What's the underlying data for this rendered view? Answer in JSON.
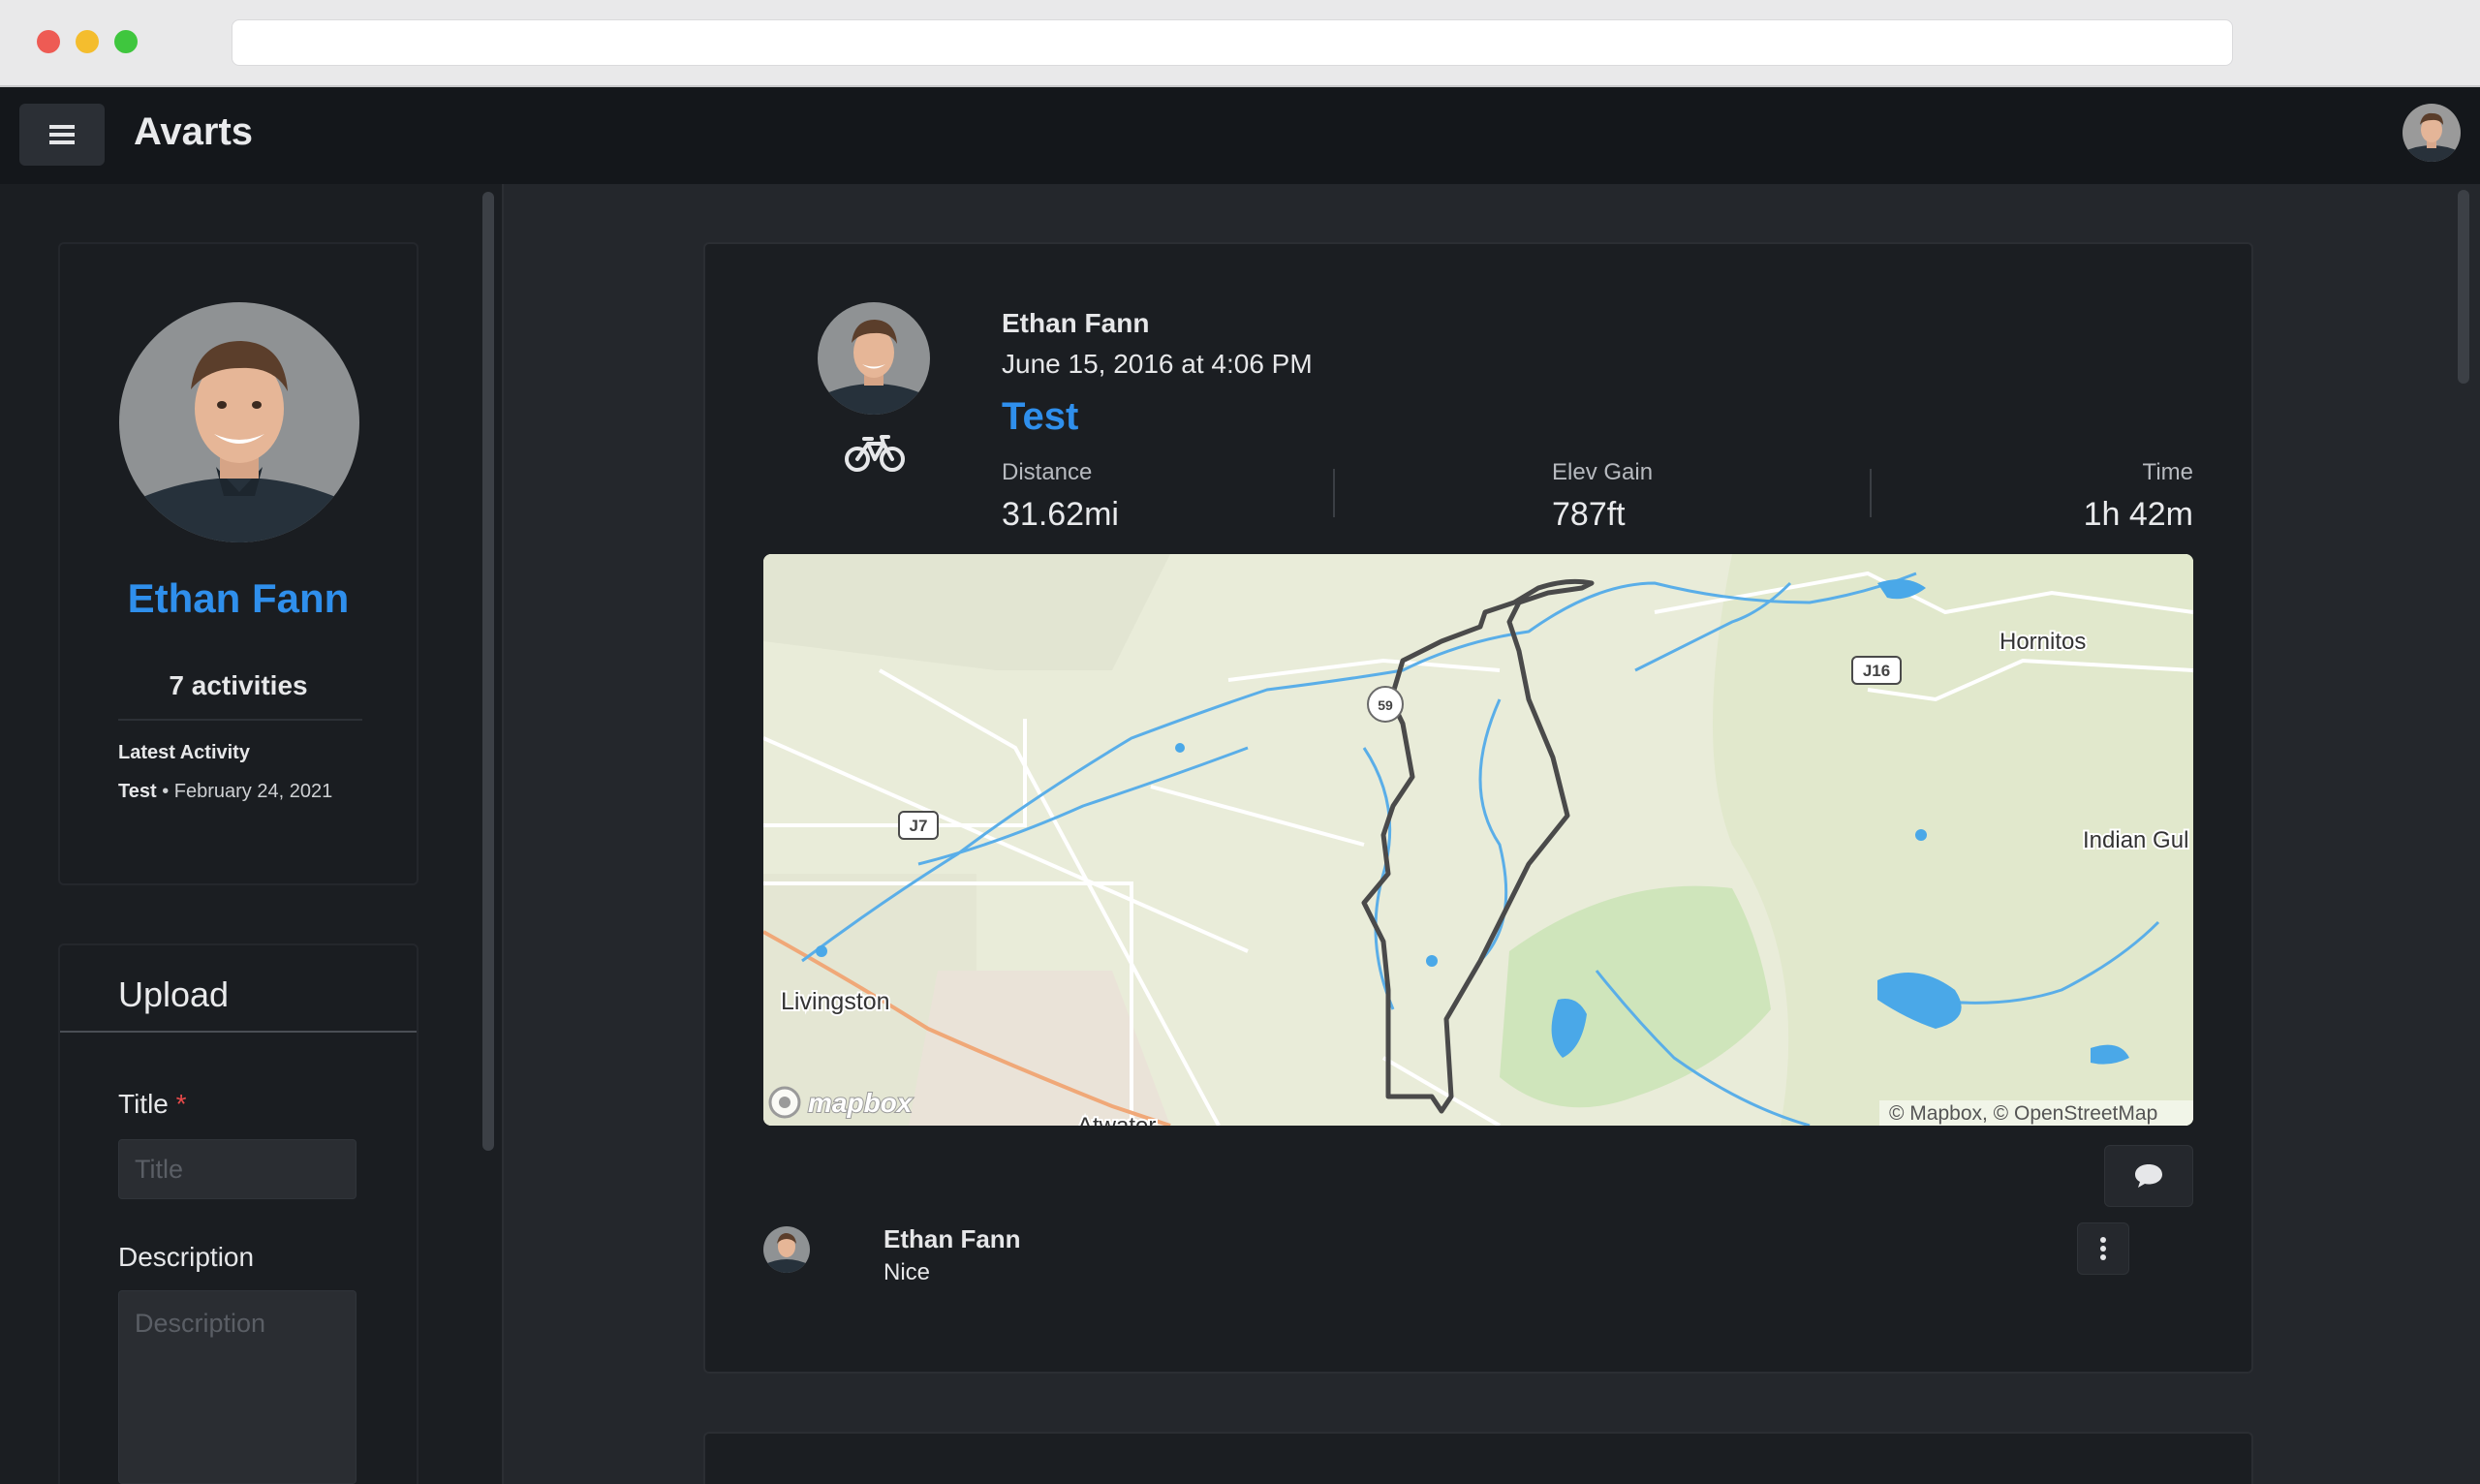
{
  "app": {
    "brand": "Avarts"
  },
  "profile": {
    "name": "Ethan Fann",
    "activity_count": "7 activities",
    "latest_label": "Latest Activity",
    "latest_title": "Test",
    "latest_separator": " • ",
    "latest_date": "February 24, 2021"
  },
  "upload": {
    "heading": "Upload",
    "title_label": "Title",
    "required_mark": "*",
    "title_placeholder": "Title",
    "description_label": "Description",
    "description_placeholder": "Description"
  },
  "activity": {
    "athlete": "Ethan Fann",
    "date": "June 15, 2016 at 4:06 PM",
    "title": "Test",
    "sport_icon": "bicycle-icon",
    "stats": {
      "distance_label": "Distance",
      "distance_value": "31.62mi",
      "elev_label": "Elev Gain",
      "elev_value": "787ft",
      "time_label": "Time",
      "time_value": "1h 42m"
    },
    "map": {
      "places": [
        "Hornitos",
        "Indian Gul",
        "Livingston",
        "Atwater"
      ],
      "shields": [
        "J16",
        "J7",
        "59"
      ],
      "logo": "mapbox",
      "attribution": "© Mapbox, © OpenStreetMap"
    }
  },
  "comments": [
    {
      "author": "Ethan Fann",
      "text": "Nice"
    }
  ],
  "colors": {
    "accent": "#2f8fec",
    "route": "#4a4a4a",
    "water": "#4aa8e8",
    "park": "#c9e3b6"
  }
}
